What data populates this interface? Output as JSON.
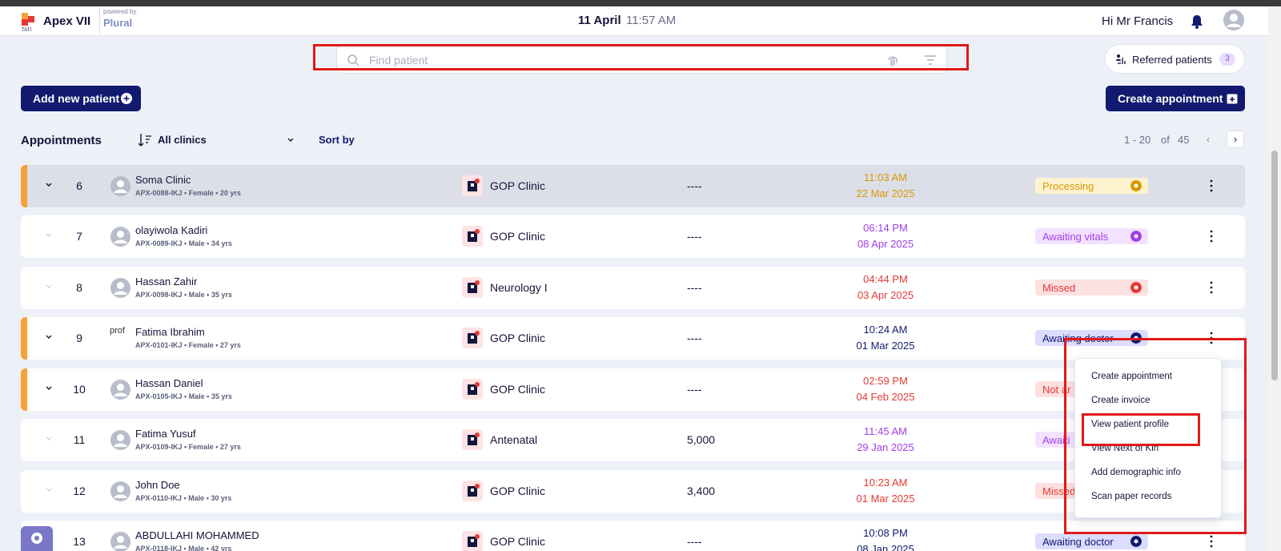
{
  "header": {
    "app_name": "Apex VII",
    "powered_by": "powered by",
    "partner": "Plural",
    "date": "11 April",
    "time": "11:57 AM",
    "greeting": "Hi Mr Francis"
  },
  "search": {
    "placeholder": "Find patient",
    "value": ""
  },
  "referred": {
    "label": "Referred patients",
    "count": "3"
  },
  "actions": {
    "add_patient": "Add new patient",
    "create_appointment": "Create appointment"
  },
  "toolbar": {
    "title": "Appointments",
    "clinic_filter": "All clinics",
    "sort_by": "Sort by",
    "pager_range": "1 - 20",
    "pager_of": "of",
    "pager_total": "45",
    "prev": "‹",
    "next": "›"
  },
  "colors": {
    "primary": "#111a6e",
    "accent_stripe": "#f6a136",
    "processing": "#d69a00",
    "vitals": "#a13fe6",
    "missed": "#e53935",
    "doctor": "#111a6e",
    "highlight": "#e01919"
  },
  "rows": [
    {
      "num": "6",
      "name": "Soma Clinic",
      "meta": "APX-0088-IKJ • Female • 20 yrs",
      "clinic": "GOP Clinic",
      "amount": "----",
      "time": "11:03 AM",
      "date": "22 Mar 2025",
      "status": "Processing"
    },
    {
      "num": "7",
      "name": "olayiwola Kadiri",
      "meta": "APX-0089-IKJ • Male • 34 yrs",
      "clinic": "GOP Clinic",
      "amount": "----",
      "time": "06:14 PM",
      "date": "08 Apr 2025",
      "status": "Awaiting vitals"
    },
    {
      "num": "8",
      "name": "Hassan Zahir",
      "meta": "APX-0098-IKJ • Male • 35 yrs",
      "clinic": "Neurology I",
      "amount": "----",
      "time": "04:44 PM",
      "date": "03 Apr 2025",
      "status": "Missed"
    },
    {
      "num": "9",
      "name": "Fatima Ibrahim",
      "meta": "APX-0101-IKJ • Female • 27 yrs",
      "clinic": "GOP Clinic",
      "amount": "----",
      "time": "10:24 AM",
      "date": "01 Mar 2025",
      "status": "Awaiting doctor",
      "avatar_alt": "prof"
    },
    {
      "num": "10",
      "name": "Hassan Daniel",
      "meta": "APX-0105-IKJ • Male • 35 yrs",
      "clinic": "GOP Clinic",
      "amount": "----",
      "time": "02:59 PM",
      "date": "04 Feb 2025",
      "status": "Not ar"
    },
    {
      "num": "11",
      "name": "Fatima Yusuf",
      "meta": "APX-0109-IKJ • Female • 27 yrs",
      "clinic": "Antenatal",
      "amount": "5,000",
      "time": "11:45 AM",
      "date": "29 Jan 2025",
      "status": "Awaiti"
    },
    {
      "num": "12",
      "name": "John Doe",
      "meta": "APX-0110-IKJ • Male • 30 yrs",
      "clinic": "GOP Clinic",
      "amount": "3,400",
      "time": "10:23 AM",
      "date": "01 Mar 2025",
      "status": "Missed"
    },
    {
      "num": "13",
      "name": "ABDULLAHI MOHAMMED",
      "meta": "APX-0118-IKJ • Male • 42 yrs",
      "clinic": "GOP Clinic",
      "amount": "----",
      "time": "10:08 PM",
      "date": "08 Jan 2025",
      "status": "Awaiting doctor"
    }
  ],
  "context_menu": {
    "items": [
      "Create appointment",
      "Create invoice",
      "View patient profile",
      "View Next of Kin",
      "Add demographic info",
      "Scan paper records"
    ]
  }
}
